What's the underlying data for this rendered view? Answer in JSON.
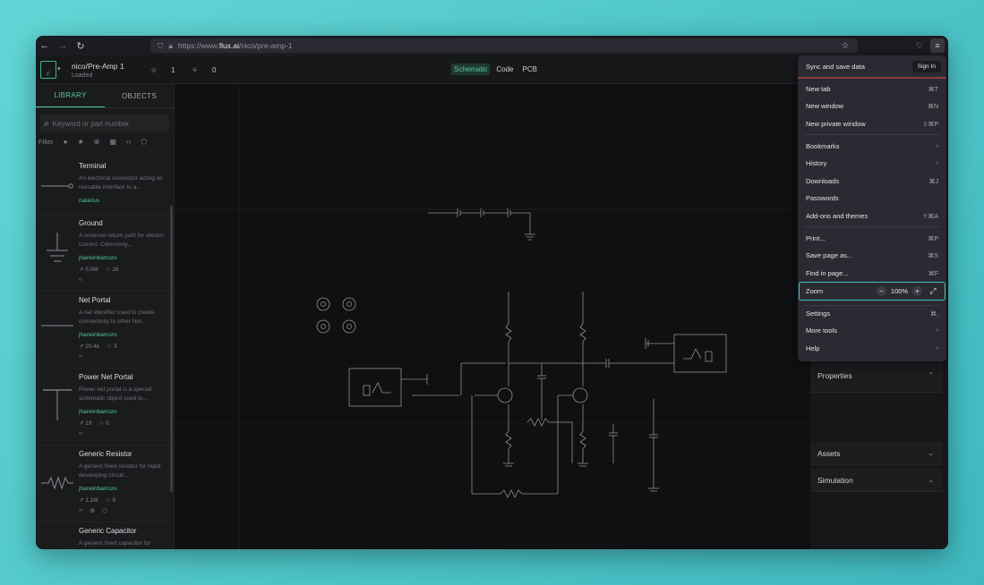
{
  "browser": {
    "url_prefix": "https://www.",
    "url_host": "flux.ai",
    "url_path": "/nico/pre-amp-1"
  },
  "app": {
    "project_title": "nico/Pre-Amp 1",
    "project_status": "Loaded",
    "star_count": "1",
    "fork_count": "0",
    "view_tabs": [
      "Schematic",
      "Code",
      "PCB"
    ]
  },
  "left_panel": {
    "tabs": [
      "LIBRARY",
      "OBJECTS"
    ],
    "search_placeholder": "Keyword or part number",
    "filter_label": "Filter",
    "items": [
      {
        "name": "Terminal",
        "desc": "An electrical connector acting as reusable interface to a...",
        "author": "natarius",
        "trend": "",
        "stars": ""
      },
      {
        "name": "Ground",
        "desc": "A common return path for electric current. Commonly...",
        "author": "jharwinbarrozo",
        "trend": "5.0M",
        "stars": "26"
      },
      {
        "name": "Net Portal",
        "desc": "A net identifier used to create connectivity to other Net...",
        "author": "jharwinbarrozo",
        "trend": "20.4k",
        "stars": "3"
      },
      {
        "name": "Power Net Portal",
        "desc": "Power net portal is a special schematic object used to...",
        "author": "jharwinbarrozo",
        "trend": "19",
        "stars": "0"
      },
      {
        "name": "Generic Resistor",
        "desc": "A generic fixed resistor for rapid developing circuit...",
        "author": "jharwinbarrozo",
        "trend": "1.1M",
        "stars": "9"
      },
      {
        "name": "Generic Capacitor",
        "desc": "A generic fixed capacitor for",
        "author": "",
        "trend": "",
        "stars": ""
      }
    ]
  },
  "right_panel": {
    "sections": [
      "Properties",
      "Assets",
      "Simulation"
    ]
  },
  "firefox_menu": {
    "sync_label": "Sync and save data",
    "sign_in": "Sign In",
    "items": [
      {
        "label": "New tab",
        "shortcut": "⌘T"
      },
      {
        "label": "New window",
        "shortcut": "⌘N"
      },
      {
        "label": "New private window",
        "shortcut": "⇧⌘P"
      },
      {
        "label": "Bookmarks",
        "shortcut": "›"
      },
      {
        "label": "History",
        "shortcut": "›"
      },
      {
        "label": "Downloads",
        "shortcut": "⌘J"
      },
      {
        "label": "Passwords",
        "shortcut": ""
      },
      {
        "label": "Add-ons and themes",
        "shortcut": "⇧⌘A"
      },
      {
        "label": "Print...",
        "shortcut": "⌘P"
      },
      {
        "label": "Save page as...",
        "shortcut": "⌘S"
      },
      {
        "label": "Find in page...",
        "shortcut": "⌘F"
      },
      {
        "label": "Settings",
        "shortcut": "⌘,"
      },
      {
        "label": "More tools",
        "shortcut": "›"
      },
      {
        "label": "Help",
        "shortcut": "›"
      }
    ],
    "zoom_label": "Zoom",
    "zoom_value": "100%",
    "zoom_minus": "−",
    "zoom_plus": "+"
  }
}
